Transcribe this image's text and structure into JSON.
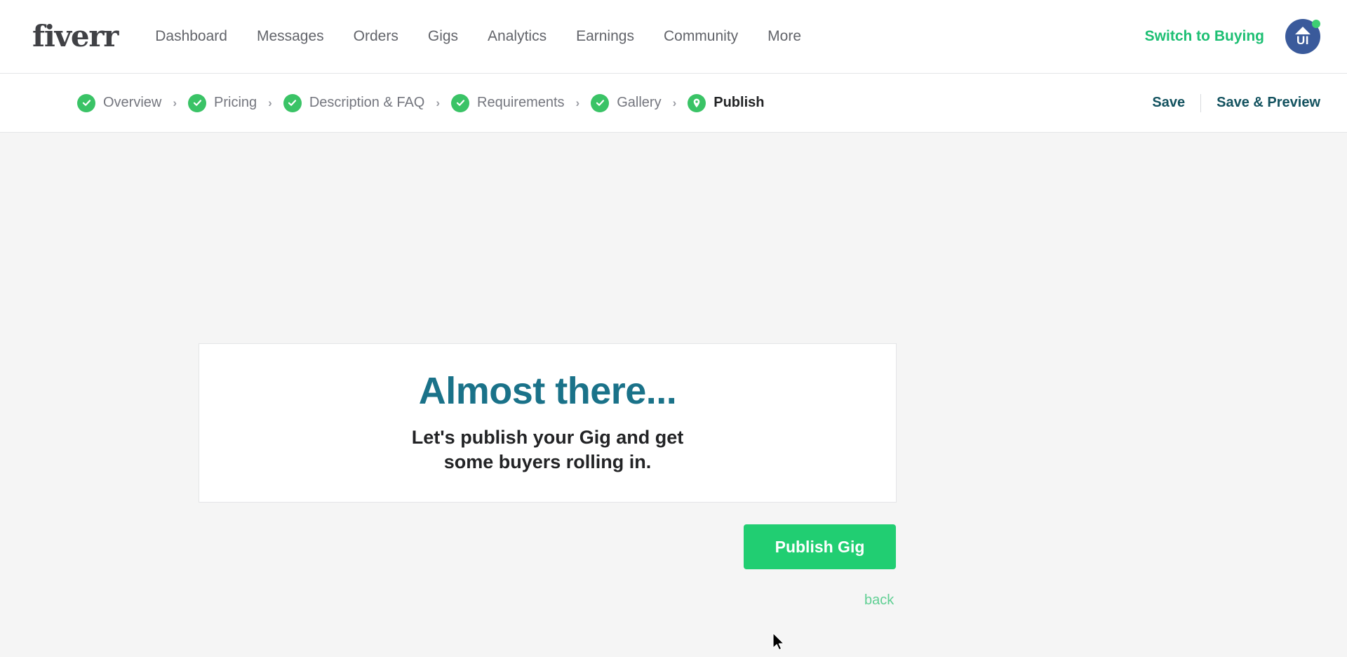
{
  "brand": {
    "logo_text": "fiverr",
    "accent_green": "#1dbf73",
    "step_green": "#3ac366",
    "button_green": "#21ce72",
    "title_teal": "#1a7289",
    "save_navy": "#13525f"
  },
  "topnav": {
    "items": [
      {
        "label": "Dashboard"
      },
      {
        "label": "Messages"
      },
      {
        "label": "Orders"
      },
      {
        "label": "Gigs"
      },
      {
        "label": "Analytics"
      },
      {
        "label": "Earnings"
      },
      {
        "label": "Community"
      },
      {
        "label": "More"
      }
    ],
    "switch_label": "Switch to Buying",
    "avatar_initials": "UI",
    "avatar_status": "online"
  },
  "steps": {
    "items": [
      {
        "label": "Overview",
        "state": "complete",
        "icon": "check-icon"
      },
      {
        "label": "Pricing",
        "state": "complete",
        "icon": "check-icon"
      },
      {
        "label": "Description & FAQ",
        "state": "complete",
        "icon": "check-icon"
      },
      {
        "label": "Requirements",
        "state": "complete",
        "icon": "check-icon"
      },
      {
        "label": "Gallery",
        "state": "complete",
        "icon": "check-icon"
      },
      {
        "label": "Publish",
        "state": "current",
        "icon": "location-pin-icon"
      }
    ],
    "separator": "›",
    "save_label": "Save",
    "save_preview_label": "Save & Preview"
  },
  "main": {
    "card_title": "Almost there...",
    "card_subtitle_line1": "Let's publish your Gig and get",
    "card_subtitle_line2": "some buyers rolling in.",
    "publish_button_label": "Publish Gig",
    "back_link_label": "back"
  }
}
